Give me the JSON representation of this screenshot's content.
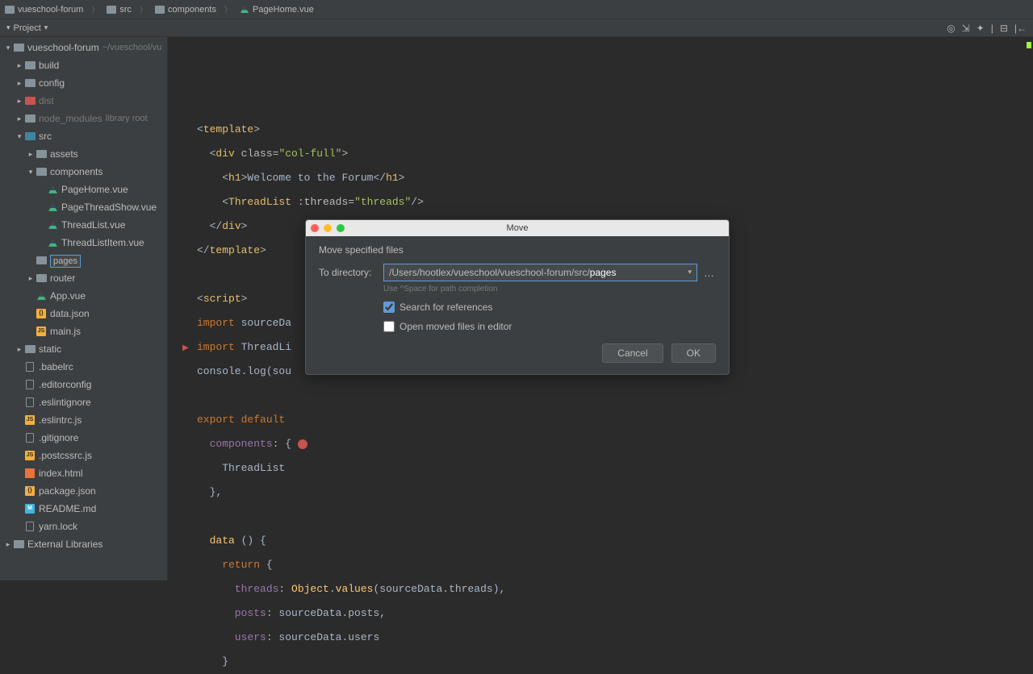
{
  "breadcrumbs": [
    {
      "label": "vueschool-forum",
      "type": "folder"
    },
    {
      "label": "src",
      "type": "folder"
    },
    {
      "label": "components",
      "type": "folder"
    },
    {
      "label": "PageHome.vue",
      "type": "vue"
    }
  ],
  "toolHeader": {
    "label": "Project"
  },
  "tree": [
    {
      "depth": 0,
      "arrow": "down",
      "icon": "folder",
      "label": "vueschool-forum",
      "extra": "~/vueschool/vu"
    },
    {
      "depth": 1,
      "arrow": "right",
      "icon": "folder",
      "label": "build"
    },
    {
      "depth": 1,
      "arrow": "right",
      "icon": "folder",
      "label": "config"
    },
    {
      "depth": 1,
      "arrow": "right",
      "icon": "folder-red",
      "label": "dist",
      "dim": true
    },
    {
      "depth": 1,
      "arrow": "right",
      "icon": "folder",
      "label": "node_modules",
      "dim": true,
      "extra": "library root"
    },
    {
      "depth": 1,
      "arrow": "down",
      "icon": "folder-blue",
      "label": "src"
    },
    {
      "depth": 2,
      "arrow": "right",
      "icon": "folder",
      "label": "assets"
    },
    {
      "depth": 2,
      "arrow": "down",
      "icon": "folder",
      "label": "components"
    },
    {
      "depth": 3,
      "arrow": "none",
      "icon": "vue",
      "label": "PageHome.vue"
    },
    {
      "depth": 3,
      "arrow": "none",
      "icon": "vue",
      "label": "PageThreadShow.vue"
    },
    {
      "depth": 3,
      "arrow": "none",
      "icon": "vue",
      "label": "ThreadList.vue"
    },
    {
      "depth": 3,
      "arrow": "none",
      "icon": "vue",
      "label": "ThreadListItem.vue"
    },
    {
      "depth": 2,
      "arrow": "none",
      "icon": "folder",
      "label": "pages",
      "editing": true
    },
    {
      "depth": 2,
      "arrow": "right",
      "icon": "folder",
      "label": "router"
    },
    {
      "depth": 2,
      "arrow": "none",
      "icon": "vue",
      "label": "App.vue"
    },
    {
      "depth": 2,
      "arrow": "none",
      "icon": "json",
      "label": "data.json"
    },
    {
      "depth": 2,
      "arrow": "none",
      "icon": "js",
      "label": "main.js"
    },
    {
      "depth": 1,
      "arrow": "right",
      "icon": "folder",
      "label": "static"
    },
    {
      "depth": 1,
      "arrow": "none",
      "icon": "file",
      "label": ".babelrc"
    },
    {
      "depth": 1,
      "arrow": "none",
      "icon": "file",
      "label": ".editorconfig"
    },
    {
      "depth": 1,
      "arrow": "none",
      "icon": "file",
      "label": ".eslintignore"
    },
    {
      "depth": 1,
      "arrow": "none",
      "icon": "js",
      "label": ".eslintrc.js"
    },
    {
      "depth": 1,
      "arrow": "none",
      "icon": "file",
      "label": ".gitignore"
    },
    {
      "depth": 1,
      "arrow": "none",
      "icon": "js",
      "label": ".postcssrc.js"
    },
    {
      "depth": 1,
      "arrow": "none",
      "icon": "html",
      "label": "index.html"
    },
    {
      "depth": 1,
      "arrow": "none",
      "icon": "json",
      "label": "package.json"
    },
    {
      "depth": 1,
      "arrow": "none",
      "icon": "md",
      "label": "README.md"
    },
    {
      "depth": 1,
      "arrow": "none",
      "icon": "file",
      "label": "yarn.lock"
    },
    {
      "depth": 0,
      "arrow": "right",
      "icon": "folder",
      "label": "External Libraries"
    }
  ],
  "editor": {
    "lines": [
      [
        {
          "t": "def",
          "v": "<"
        },
        {
          "t": "tag",
          "v": "template"
        },
        {
          "t": "def",
          "v": ">"
        }
      ],
      [
        {
          "t": "def",
          "v": "  <"
        },
        {
          "t": "tag",
          "v": "div "
        },
        {
          "t": "attr",
          "v": "class="
        },
        {
          "t": "str",
          "v": "\"col-full\""
        },
        {
          "t": "def",
          "v": ">"
        }
      ],
      [
        {
          "t": "def",
          "v": "    <"
        },
        {
          "t": "tag",
          "v": "h1"
        },
        {
          "t": "def",
          "v": ">Welcome to the Forum</"
        },
        {
          "t": "tag",
          "v": "h1"
        },
        {
          "t": "def",
          "v": ">"
        }
      ],
      [
        {
          "t": "def",
          "v": "    <"
        },
        {
          "t": "comp",
          "v": "ThreadList "
        },
        {
          "t": "attr",
          "v": ":threads="
        },
        {
          "t": "str",
          "v": "\"threads\""
        },
        {
          "t": "def",
          "v": "/>"
        }
      ],
      [
        {
          "t": "def",
          "v": "  </"
        },
        {
          "t": "tag",
          "v": "div"
        },
        {
          "t": "def",
          "v": ">"
        }
      ],
      [
        {
          "t": "def",
          "v": "</"
        },
        {
          "t": "tag",
          "v": "template"
        },
        {
          "t": "def",
          "v": ">"
        }
      ],
      [],
      [
        {
          "t": "def",
          "v": "<"
        },
        {
          "t": "tag",
          "v": "script"
        },
        {
          "t": "def",
          "v": ">"
        }
      ],
      [
        {
          "t": "kw",
          "v": "import "
        },
        {
          "t": "def",
          "v": "sourceDa"
        }
      ],
      [
        {
          "t": "kw",
          "v": "import "
        },
        {
          "t": "def",
          "v": "ThreadLi"
        }
      ],
      [
        {
          "t": "def",
          "v": "console.log(sou"
        }
      ],
      [],
      [
        {
          "t": "kw",
          "v": "export default "
        }
      ],
      [
        {
          "t": "prop",
          "v": "  components"
        },
        {
          "t": "def",
          "v": ": {"
        }
      ],
      [
        {
          "t": "def",
          "v": "    ThreadList"
        }
      ],
      [
        {
          "t": "def",
          "v": "  },"
        }
      ],
      [],
      [
        {
          "t": "fn",
          "v": "  data "
        },
        {
          "t": "def",
          "v": "() {"
        }
      ],
      [
        {
          "t": "kw",
          "v": "    return "
        },
        {
          "t": "def",
          "v": "{"
        }
      ],
      [
        {
          "t": "prop",
          "v": "      threads"
        },
        {
          "t": "def",
          "v": ": "
        },
        {
          "t": "fn",
          "v": "Object"
        },
        {
          "t": "def",
          "v": "."
        },
        {
          "t": "fn",
          "v": "values"
        },
        {
          "t": "def",
          "v": "(sourceData.threads),"
        }
      ],
      [
        {
          "t": "prop",
          "v": "      posts"
        },
        {
          "t": "def",
          "v": ": sourceData.posts,"
        }
      ],
      [
        {
          "t": "prop",
          "v": "      users"
        },
        {
          "t": "def",
          "v": ": sourceData.users"
        }
      ],
      [
        {
          "t": "def",
          "v": "    }"
        }
      ]
    ]
  },
  "dialog": {
    "title": "Move",
    "subtitle": "Move specified files",
    "toDirLabel": "To directory:",
    "toDirValue": "/Users/hootlex/vueschool/vueschool-forum/src/",
    "toDirHighlight": "pages",
    "hint": "Use ^Space for path completion",
    "searchRefs": "Search for references",
    "openMoved": "Open moved files in editor",
    "cancel": "Cancel",
    "ok": "OK"
  }
}
